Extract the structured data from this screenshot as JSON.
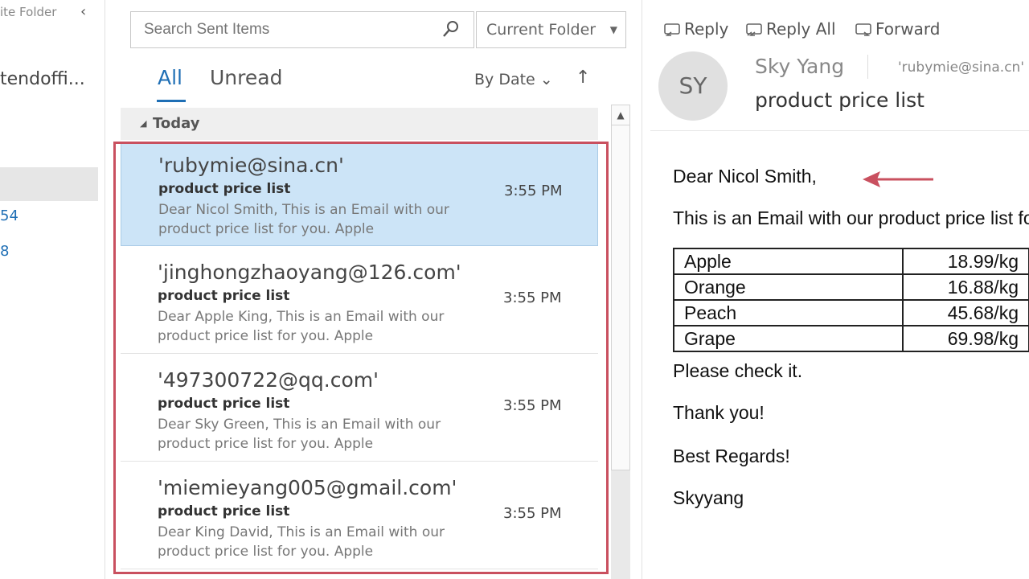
{
  "folder_pane": {
    "header": "ite Folder",
    "collapse_icon": "chevron-left-icon",
    "account": "tendoffi...",
    "count_1": "54",
    "count_2": "8"
  },
  "message_list": {
    "search_placeholder": "Search Sent Items",
    "search_icon": "search-icon",
    "scope": "Current Folder",
    "tabs": [
      {
        "label": "All",
        "active": true
      },
      {
        "label": "Unread",
        "active": false
      }
    ],
    "sort_label": "By Date",
    "sort_direction": "↑",
    "group_label": "Today",
    "messages": [
      {
        "from": "'rubymie@sina.cn'",
        "subject": "product price list",
        "preview": "Dear Nicol Smith,  This is an Email with our product price list for you.  Apple",
        "time": "3:55 PM",
        "selected": true
      },
      {
        "from": "'jinghongzhaoyang@126.com'",
        "subject": "product price list",
        "preview": "Dear Apple King,  This is an Email with our product price list for you.  Apple",
        "time": "3:55 PM",
        "selected": false
      },
      {
        "from": "'497300722@qq.com'",
        "subject": "product price list",
        "preview": "Dear Sky Green,  This is an Email with our product price list for you.  Apple",
        "time": "3:55 PM",
        "selected": false
      },
      {
        "from": "'miemieyang005@gmail.com'",
        "subject": "product price list",
        "preview": "Dear King David,  This is an Email with our product price list for you.  Apple",
        "time": "3:55 PM",
        "selected": false
      }
    ]
  },
  "reading_pane": {
    "actions": [
      {
        "label": "Reply",
        "icon": "reply-icon"
      },
      {
        "label": "Reply All",
        "icon": "reply-all-icon"
      },
      {
        "label": "Forward",
        "icon": "forward-icon"
      }
    ],
    "avatar_initials": "SY",
    "sender": "Sky Yang",
    "to": "'rubymie@sina.cn'",
    "subject": "product price list",
    "greeting": "Dear Nicol Smith,",
    "intro": "This is an Email with our product price list for you.",
    "prices": [
      {
        "item": "Apple",
        "price": "18.99/kg"
      },
      {
        "item": "Orange",
        "price": "16.88/kg"
      },
      {
        "item": "Peach",
        "price": "45.68/kg"
      },
      {
        "item": "Grape",
        "price": "69.98/kg"
      }
    ],
    "check": "Please check it.",
    "thanks": "Thank you!",
    "regards": "Best Regards!",
    "signature": "Skyyang"
  },
  "colors": {
    "accent": "#1f6fb5",
    "selection": "#cce4f7",
    "annotation": "#c9505f"
  }
}
